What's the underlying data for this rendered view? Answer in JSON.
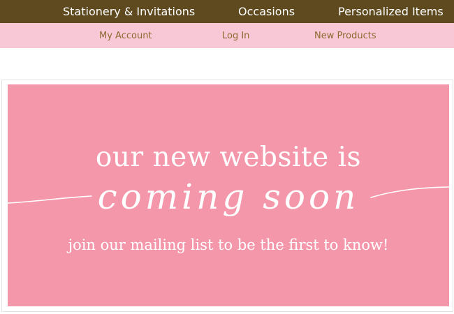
{
  "top_nav": {
    "items": [
      {
        "label": "Stationery & Invitations"
      },
      {
        "label": "Occasions"
      },
      {
        "label": "Personalized Items"
      }
    ],
    "background": "#5e4a1e",
    "text_color": "#ffffff"
  },
  "sub_nav": {
    "items": [
      {
        "label": "My Account"
      },
      {
        "label": "Log In"
      },
      {
        "label": "New Products"
      }
    ],
    "background": "#f9c8d6",
    "text_color": "#8b6a2f"
  },
  "banner": {
    "headline": "our new website is",
    "script_text": "coming soon",
    "tagline": "join our mailing list to be the first to know!",
    "background": "#f497aa",
    "text_color": "#ffffff"
  }
}
